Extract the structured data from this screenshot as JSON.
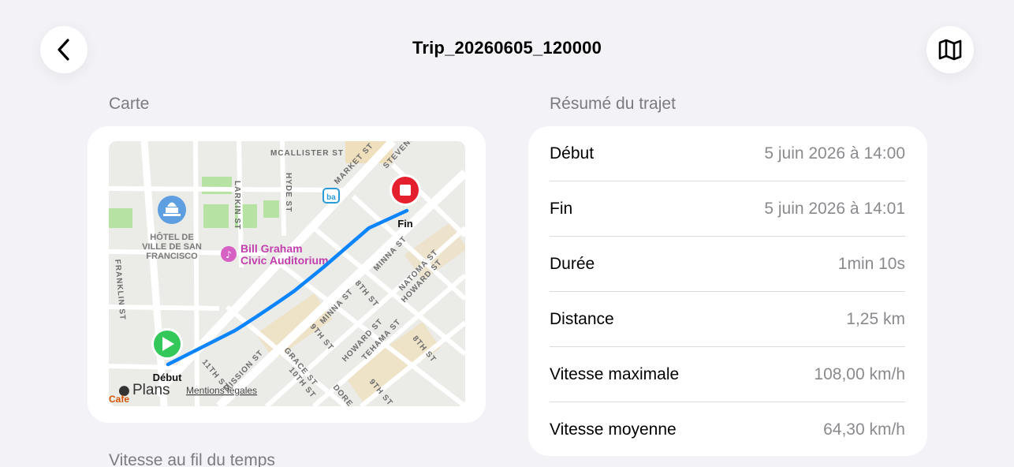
{
  "header": {
    "title": "Trip_20260605_120000",
    "back_icon": "chevron-left-icon",
    "map_icon": "map-icon"
  },
  "sections": {
    "map": "Carte",
    "summary": "Résumé du trajet",
    "speed_chart": "Vitesse au fil du temps"
  },
  "map": {
    "streets": {
      "mcallister": "MCALLISTER ST",
      "larkin": "LARKIN ST",
      "hyde": "HYDE ST",
      "market": "MARKET ST",
      "stevenson": "STEVENSO",
      "franklin": "FRANKLIN ST",
      "minna1": "MINNA ST",
      "minna2": "MINNA ST",
      "natoma": "NATOMA ST",
      "eighth1": "8TH ST",
      "eighth2": "8TH ST",
      "ninth1": "9TH ST",
      "ninth2": "9TH ST",
      "howard1": "HOWARD ST",
      "howard2": "HOWARD ST",
      "mission": "MISSION ST",
      "grace": "GRACE ST",
      "tenth": "10TH ST",
      "tehama": "TEHAMA ST",
      "eleventh": "11TH ST",
      "dore": "DORE"
    },
    "poi": {
      "city_hall_1": "HÔTEL DE",
      "city_hall_2": "VILLE DE SAN",
      "city_hall_3": "FRANCISCO",
      "auditorium_1": "Bill Graham",
      "auditorium_2": "Civic Auditorium",
      "cafe": "Cafe"
    },
    "start_label": "Début",
    "end_label": "Fin",
    "brand": "Plans",
    "legal": "Mentions légales",
    "route_color": "#0a84ff",
    "start_color": "#34c759",
    "end_color": "#e5202e"
  },
  "summary": {
    "rows": [
      {
        "label": "Début",
        "value": "5 juin 2026 à 14:00"
      },
      {
        "label": "Fin",
        "value": "5 juin 2026 à 14:01"
      },
      {
        "label": "Durée",
        "value": "1min 10s"
      },
      {
        "label": "Distance",
        "value": "1,25 km"
      },
      {
        "label": "Vitesse maximale",
        "value": "108,00 km/h"
      },
      {
        "label": "Vitesse moyenne",
        "value": "64,30 km/h"
      }
    ]
  }
}
